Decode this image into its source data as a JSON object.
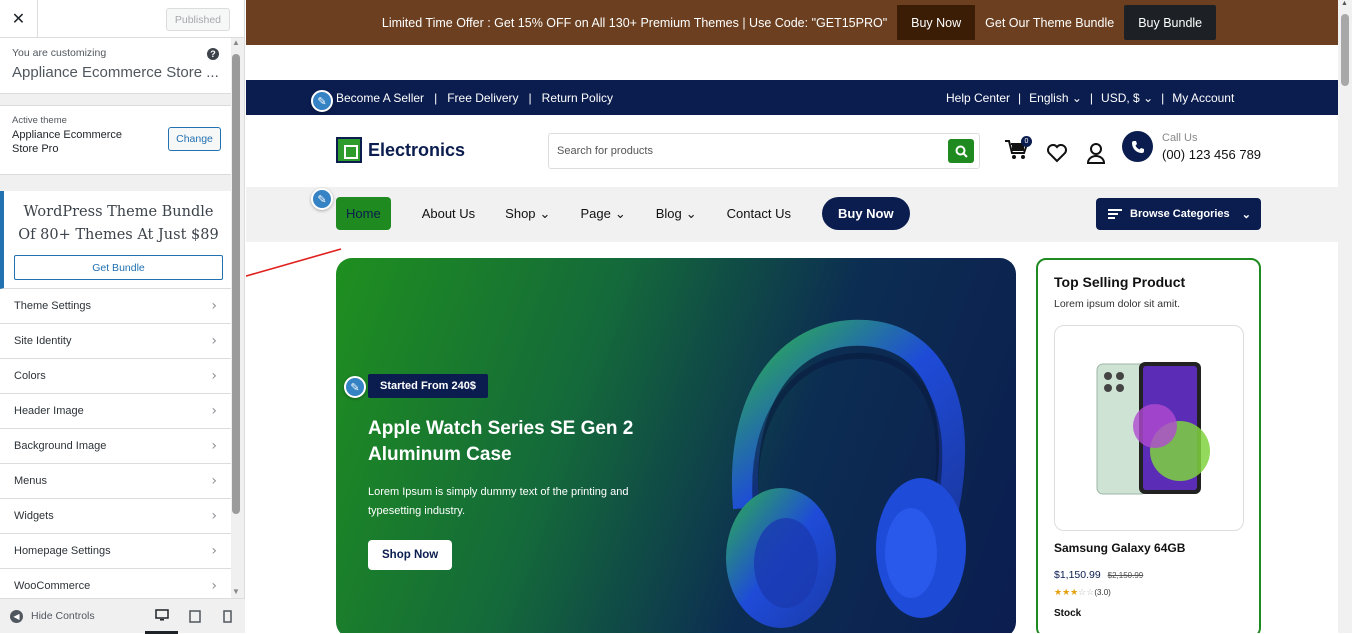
{
  "sidebar": {
    "published_label": "Published",
    "customizing_label": "You are customizing",
    "store_name": "Appliance Ecommerce Store ...",
    "active_theme_label": "Active theme",
    "theme_name": "Appliance Ecommerce Store Pro",
    "change_label": "Change",
    "bundle_text": "WordPress Theme Bundle Of 80+ Themes At Just $89",
    "bundle_button": "Get Bundle",
    "items": [
      {
        "label": "Theme Settings"
      },
      {
        "label": "Site Identity"
      },
      {
        "label": "Colors"
      },
      {
        "label": "Header Image"
      },
      {
        "label": "Background Image"
      },
      {
        "label": "Menus"
      },
      {
        "label": "Widgets"
      },
      {
        "label": "Homepage Settings"
      },
      {
        "label": "WooCommerce"
      }
    ],
    "hide_controls": "Hide Controls"
  },
  "promo": {
    "text": "Limited Time Offer : Get 15% OFF on All 130+ Premium Themes | Use Code: \"GET15PRO\"",
    "buy_now": "Buy Now",
    "bundle_text": "Get Our Theme Bundle",
    "buy_bundle": "Buy Bundle"
  },
  "topnav": {
    "left": [
      "Become A Seller",
      "Free Delivery",
      "Return Policy"
    ],
    "help": "Help Center",
    "language": "English",
    "currency": "USD, $",
    "account": "My Account"
  },
  "header": {
    "logo": "Electronics",
    "search_placeholder": "Search for products",
    "cart_count": "0",
    "call_label": "Call Us",
    "call_number": "(00) 123 456 789"
  },
  "mainnav": {
    "items": [
      "Home",
      "About Us",
      "Shop",
      "Page",
      "Blog",
      "Contact Us"
    ],
    "buy_now": "Buy Now",
    "browse": "Browse Categories"
  },
  "hero": {
    "tag": "Started From 240$",
    "title": "Apple Watch Series SE Gen 2 Aluminum Case",
    "desc": "Lorem Ipsum is simply dummy text of the printing and typesetting industry.",
    "cta": "Shop Now"
  },
  "side": {
    "title": "Top Selling Product",
    "subtitle": "Lorem ipsum dolor sit amit.",
    "product": "Samsung Galaxy 64GB",
    "price": "$1,150.99",
    "old_price": "$2,150.99",
    "rating": "(3.0)",
    "stock": "Stock"
  }
}
